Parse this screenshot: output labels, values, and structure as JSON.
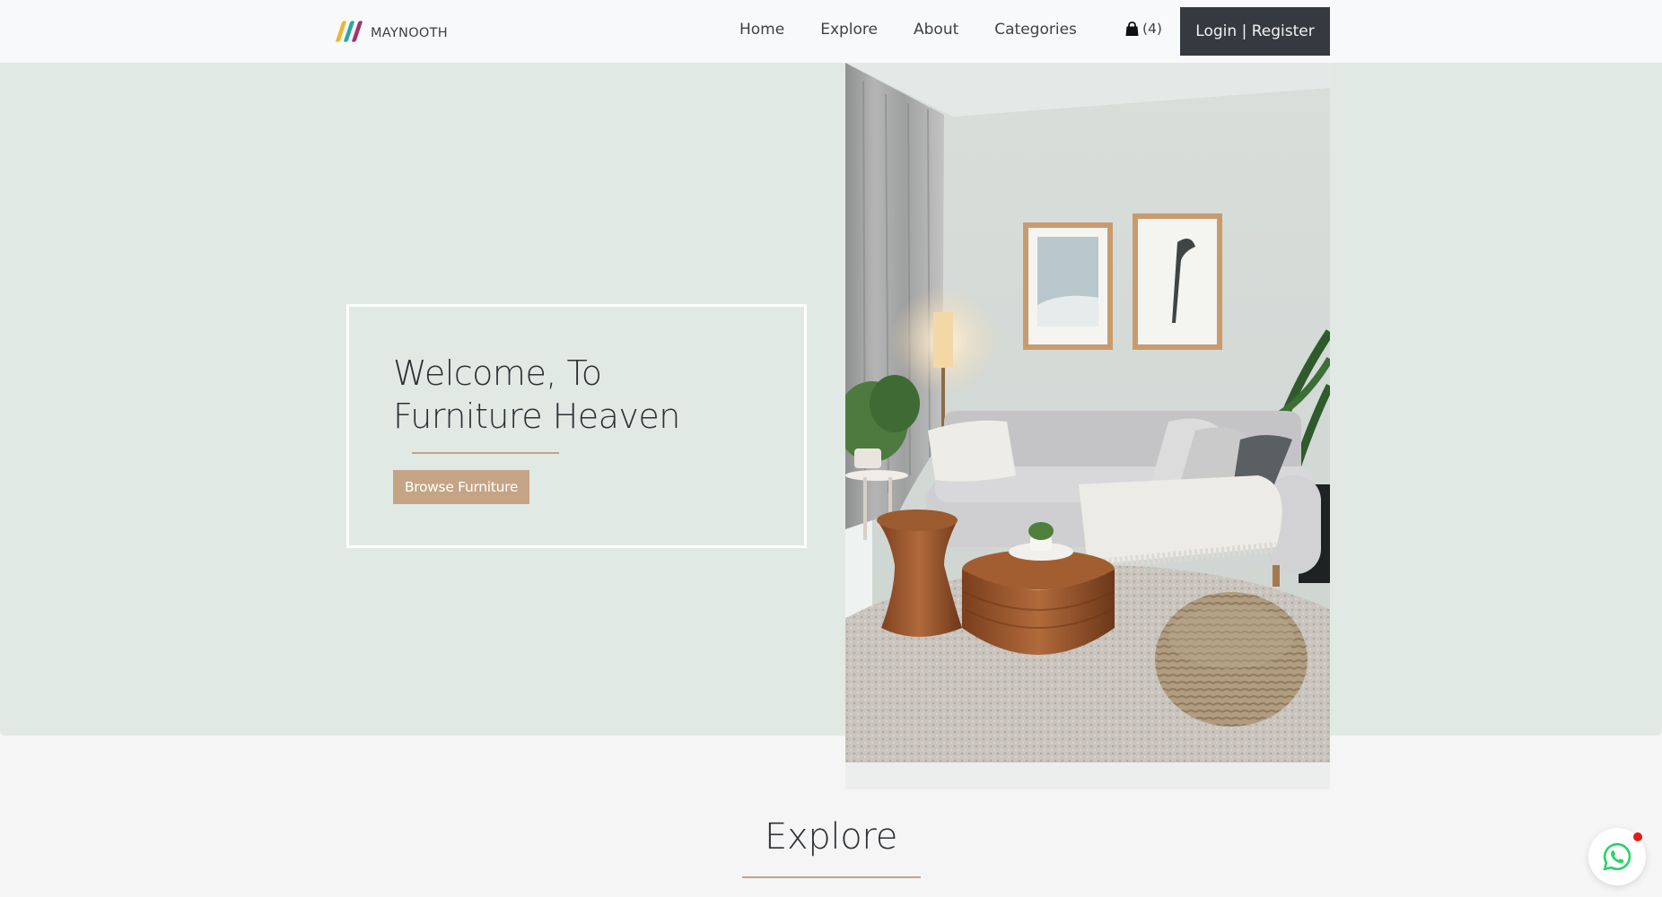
{
  "brand": {
    "name": "MAYNOOTH",
    "logo_colors": [
      "#f2b233",
      "#2aa7a4",
      "#a6316f"
    ]
  },
  "nav": {
    "links": [
      {
        "label": "Home"
      },
      {
        "label": "Explore"
      },
      {
        "label": "About"
      },
      {
        "label": "Categories"
      }
    ],
    "cart": {
      "icon": "shopping-bag-icon",
      "count_label": "(4)"
    },
    "login_label": "Login | Register"
  },
  "hero": {
    "title_line1": "Welcome, To",
    "title_line2": "Furniture Heaven",
    "cta_label": "Browse Furniture",
    "image_description_icon": "living-room-photo"
  },
  "explore": {
    "title": "Explore"
  },
  "whatsapp": {
    "icon": "whatsapp-icon",
    "has_notification": true
  },
  "colors": {
    "hero_bg": "#e1e9e5",
    "accent_tan": "#c4a484",
    "dark_button": "#343a40",
    "whatsapp_green": "#25d366",
    "notification_red": "#e01b1b"
  }
}
